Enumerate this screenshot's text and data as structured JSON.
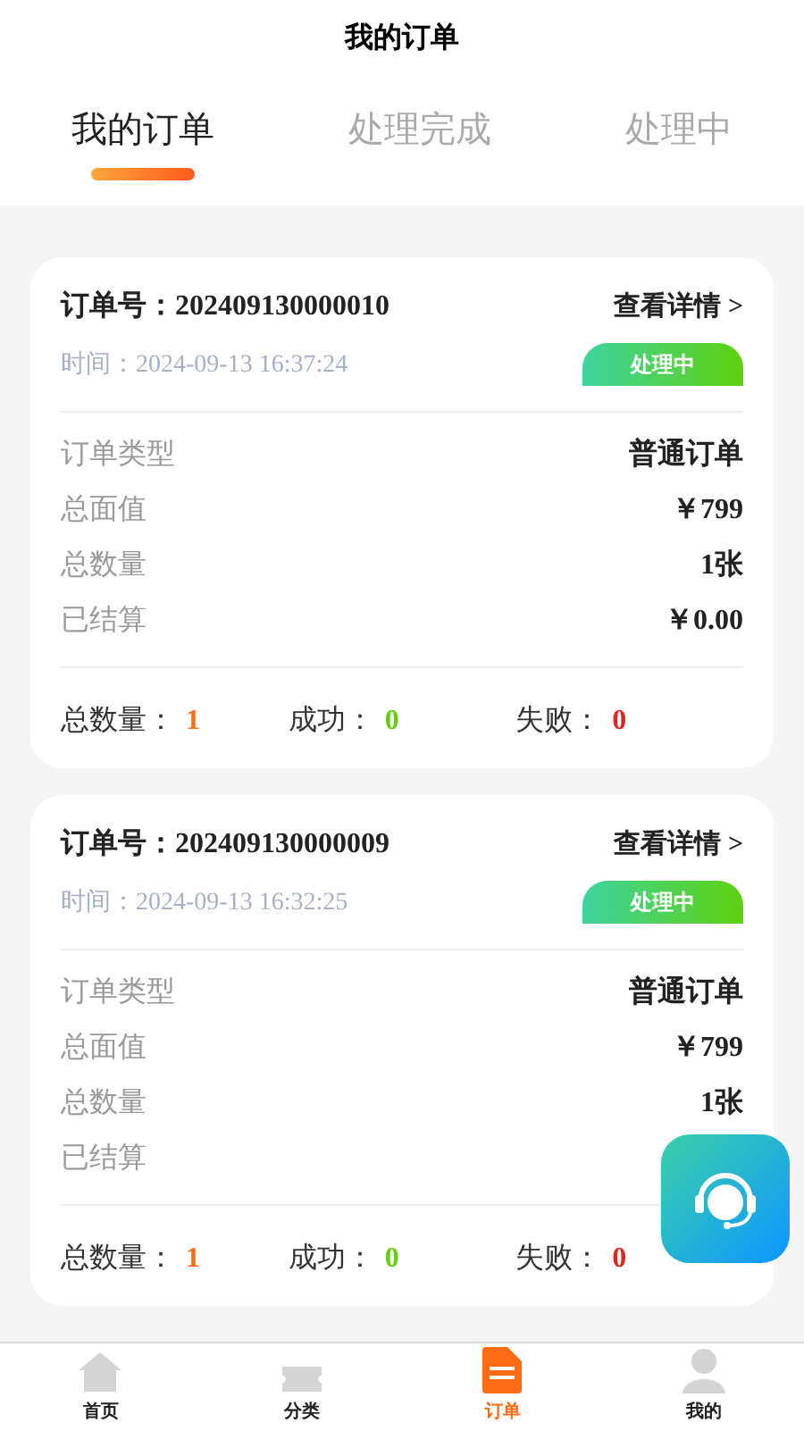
{
  "title": "我的订单",
  "tabs": [
    {
      "label": "我的订单",
      "selected": true
    },
    {
      "label": "处理完成",
      "selected": false
    },
    {
      "label": "处理中",
      "selected": false
    }
  ],
  "orders": [
    {
      "number_label": "订单号：",
      "number": "202409130000010",
      "detail_link": "查看详情 >",
      "time_label": "时间：",
      "time": "2024-09-13 16:37:24",
      "status": "处理中",
      "fields": [
        {
          "label": "订单类型",
          "value": "普通订单"
        },
        {
          "label": "总面值",
          "value": "￥799"
        },
        {
          "label": "总数量",
          "value": "1张"
        },
        {
          "label": "已结算",
          "value": "￥0.00"
        }
      ],
      "summary": [
        {
          "label": "总数量：",
          "value": "1",
          "color": "#ff6a14"
        },
        {
          "label": "成功：",
          "value": "0",
          "color": "#66cc11"
        },
        {
          "label": "失败：",
          "value": "0",
          "color": "#e62222"
        }
      ]
    },
    {
      "number_label": "订单号：",
      "number": "202409130000009",
      "detail_link": "查看详情 >",
      "time_label": "时间：",
      "time": "2024-09-13 16:32:25",
      "status": "处理中",
      "fields": [
        {
          "label": "订单类型",
          "value": "普通订单"
        },
        {
          "label": "总面值",
          "value": "￥799"
        },
        {
          "label": "总数量",
          "value": "1张"
        },
        {
          "label": "已结算"
        }
      ],
      "summary": [
        {
          "label": "总数量：",
          "value": "1",
          "color": "#ff6a14"
        },
        {
          "label": "成功：",
          "value": "0",
          "color": "#66cc11"
        },
        {
          "label": "失败：",
          "value": "0",
          "color": "#e62222"
        }
      ]
    }
  ],
  "nav": [
    {
      "label": "首页",
      "kind": "home",
      "selected": false
    },
    {
      "label": "分类",
      "kind": "ticket",
      "selected": false
    },
    {
      "label": "订单",
      "kind": "document",
      "selected": true
    },
    {
      "label": "我的",
      "kind": "person",
      "selected": false
    }
  ]
}
